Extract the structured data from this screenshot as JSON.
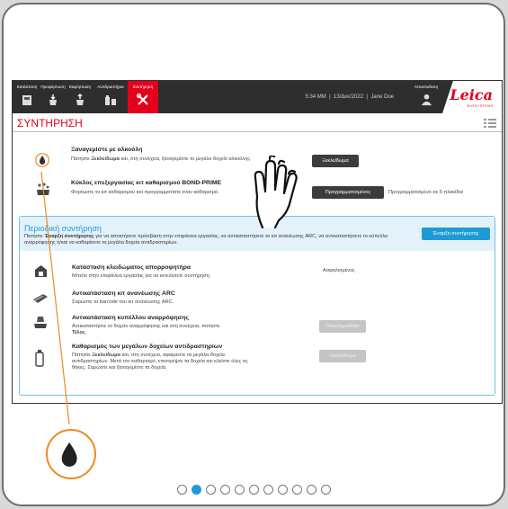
{
  "topbar": {
    "tabs": [
      {
        "label": "Κατάσταση",
        "icon": "slide-tray-icon"
      },
      {
        "label": "Προφόρτωση",
        "icon": "reagent-load-icon"
      },
      {
        "label": "Εκφόρτωση",
        "icon": "reagent-unload-icon"
      },
      {
        "label": "Αντιδραστήρια",
        "icon": "reagent-bottles-icon"
      },
      {
        "label": "Συντήρηση",
        "icon": "wrench-screwdriver-icon",
        "active": true
      }
    ],
    "time": "5:34 ΜΜ",
    "date": "13/Δεκ/2022",
    "user": "Jane Doe",
    "operator_label": "Αποσύνδεση",
    "operator_icon": "user-icon"
  },
  "logo": {
    "brand": "Leica",
    "sub": "BIOSYSTEMS"
  },
  "page": {
    "title": "ΣΥΝΤΗΡΗΣΗ",
    "menu_icon": "list-menu-icon"
  },
  "rows": [
    {
      "icon": "drop-icon",
      "title": "Ξαναγεμίστε με αλκοόλη",
      "desc_prefix": "Πατήστε ",
      "desc_bold": "Ξεκλείδωμα",
      "desc_suffix": " και, στη συνέχεια, ξαναγεμίστε το μεγάλο δοχείο αλκοόλης.",
      "button": "Ξεκλείδωμα"
    },
    {
      "icon": "cleaning-kit-icon",
      "title": "Κύκλος επεξεργασίας κιτ καθαρισμού BOND-PRIME",
      "desc": "Φορτώστε το κιτ καθαρισμού και προγραμματίστε έναν καθαρισμό.",
      "button": "Προγραμματισμένος",
      "status": "Προγραμματισμένο σε 5 πλακίδια"
    }
  ],
  "panel": {
    "title": "Περιοδική συντήρηση",
    "desc_prefix": "Πατήστε ",
    "desc_bold": "Έναρξη συντήρησης",
    "desc_suffix": " για να αποκτήσετε πρόσβαση στην επιφάνεια εργασίας, να αντικαταστήσετε το κιτ ανανέωσης ARC, να αντικαταστήσετε το κύπελλο αναρρόφησης ή/και να καθαρίσετε τα μεγάλα δοχεία αντιδραστηρίων.",
    "button": "Έναρξη συντήρησης",
    "items": [
      {
        "icon": "aspirator-lock-icon",
        "title": "Κατάσταση κλειδώματος απορροφητήρα",
        "desc": "Μπείτε στην επιφάνεια εργασίας για να εκτελέσετε συντήρηση.",
        "status": "Ασφαλισμένος"
      },
      {
        "icon": "arc-kit-icon",
        "title": "Αντικατάσταση κιτ ανανέωσης ARC",
        "desc": "Σαρώστε το barcode του κιτ ανανέωσης ARC."
      },
      {
        "icon": "aspiration-cup-icon",
        "title": "Αντικατάσταση κυπέλλου αναρρόφησης",
        "desc": "Αντικαταστήστε το δοχείο αναρρόφησης και στη συνέχεια, πατήστε",
        "desc_bold": "Τέλος",
        "button": "Ολοκληρώθηκε"
      },
      {
        "icon": "bottle-clean-icon",
        "title": "Καθαρισμός των μεγάλων δοχείων αντιδραστηρίων",
        "desc_prefix": "Πατήστε ",
        "desc_bold": "Ξεκλείδωμα",
        "desc_suffix": " και, στη συνέχεια, αφαιρέστε τα μεγάλα δοχεία αντιδραστηρίων. Μετά τον καθαρισμό, επιστρέψτε τα δοχεία και κλείστε όλες τις θήκες. Σαρώστε και ξαναγεμίστε τα δοχεία.",
        "button": "Ξεκλείδωμα"
      }
    ]
  },
  "callout": {
    "icon": "drop-icon",
    "hand_icon": "tap-hand-icon",
    "color": "#ee8a1f"
  },
  "pagination": {
    "total": 11,
    "active_index": 1
  }
}
